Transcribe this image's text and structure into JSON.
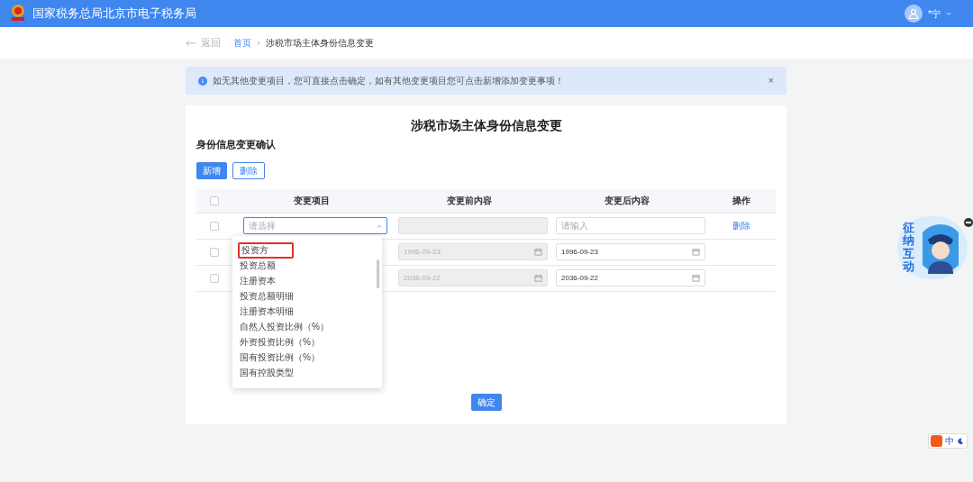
{
  "header": {
    "title": "国家税务总局北京市电子税务局",
    "user": "*宁"
  },
  "breadcrumb": {
    "back": "返回",
    "items": [
      {
        "label": "首页"
      },
      {
        "label": "涉税市场主体身份信息变更"
      }
    ]
  },
  "alert": {
    "text": "如无其他变更项目，您可直接点击确定，如有其他变更项目您可点击新增添加变更事项！",
    "close": "×"
  },
  "page_title": "涉税市场主体身份信息变更",
  "section_title": "身份信息变更确认",
  "toolbar": [
    {
      "label": "新增",
      "kind": "primary"
    },
    {
      "label": "删除",
      "kind": "outline"
    }
  ],
  "table": {
    "header_checked": false,
    "columns": [
      "变更项目",
      "变更前内容",
      "变更后内容",
      "操作"
    ],
    "rows": [
      {
        "checked": false,
        "item": {
          "placeholder": "请选择",
          "expanded": true
        },
        "before": {},
        "after": {
          "placeholder": "请输入",
          "kind": "text"
        },
        "action": "删除"
      },
      {
        "checked": false,
        "before": {
          "value": "1996-09-23"
        },
        "after": {
          "value": "1996-09-23",
          "kind": "date"
        }
      },
      {
        "checked": false,
        "before": {
          "value": "2036-09-22"
        },
        "after": {
          "value": "2036-09-22",
          "kind": "date"
        }
      }
    ]
  },
  "dropdown": {
    "options": [
      {
        "label": "投资方",
        "highlighted": true
      },
      {
        "label": "投资总额",
        "highlighted": false
      },
      {
        "label": "注册资本",
        "highlighted": false
      },
      {
        "label": "投资总额明细",
        "highlighted": false
      },
      {
        "label": "注册资本明细",
        "highlighted": false
      },
      {
        "label": "自然人投资比例（%）",
        "highlighted": false
      },
      {
        "label": "外资投资比例（%）",
        "highlighted": false
      },
      {
        "label": "国有投资比例（%）",
        "highlighted": false
      },
      {
        "label": "国有控股类型",
        "highlighted": false
      }
    ]
  },
  "confirm": "确定",
  "assistant": {
    "label": "征纳互动"
  },
  "ime": {
    "mode": "中"
  }
}
